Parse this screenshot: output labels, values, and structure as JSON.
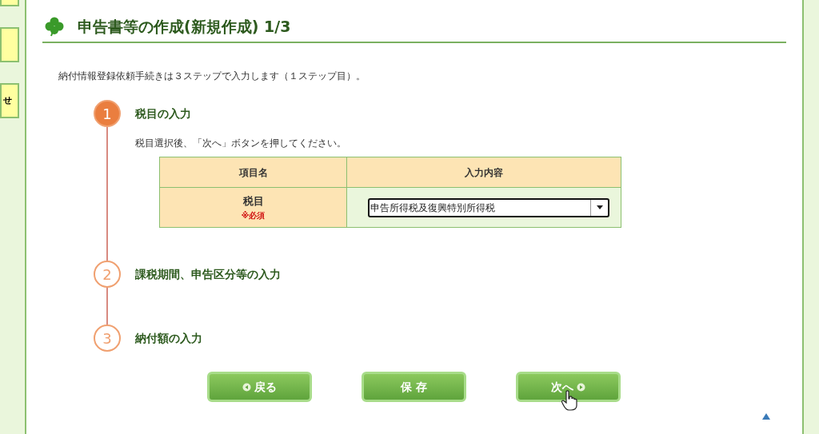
{
  "sidebar": {
    "items": [
      {
        "kind": "tab"
      },
      {
        "kind": "tab"
      },
      {
        "kind": "tab",
        "label": "せ"
      }
    ]
  },
  "header": {
    "title": "申告書等の作成(新規作成) 1/3"
  },
  "intro": "納付情報登録依頼手続きは３ステップで入力します（１ステップ目）。",
  "steps": [
    {
      "number": "1",
      "title": "税目の入力",
      "selected": true
    },
    {
      "number": "2",
      "title": "課税期間、申告区分等の入力",
      "selected": false
    },
    {
      "number": "3",
      "title": "納付額の入力",
      "selected": false
    }
  ],
  "instruction": "税目選択後、「次へ」ボタンを押してください。",
  "table": {
    "columns": [
      "項目名",
      "入力内容"
    ],
    "rows": [
      {
        "label": "税目",
        "required": "※必須",
        "value": "申告所得税及復興特別所得税"
      }
    ]
  },
  "buttons": [
    {
      "label": "戻る",
      "kind": "back"
    },
    {
      "label": "保 存",
      "kind": "save"
    },
    {
      "label": "次へ",
      "kind": "next"
    }
  ]
}
